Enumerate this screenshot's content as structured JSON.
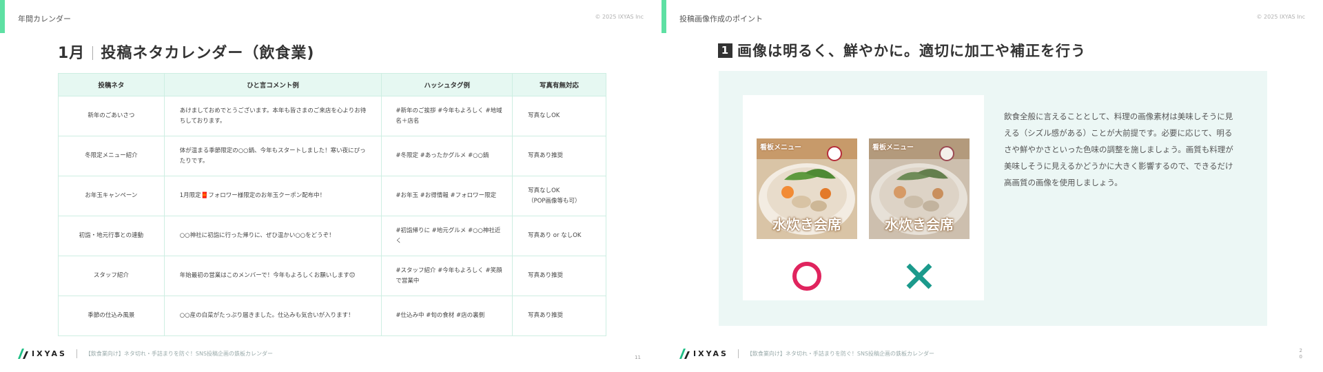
{
  "left": {
    "header": "年間カレンダー",
    "copyright": "© 2025 IXYAS Inc",
    "title_month": "1月",
    "title_text": "投稿ネタカレンダー（飲食業)",
    "table": {
      "headers": [
        "投稿ネタ",
        "ひと言コメント例",
        "ハッシュタグ例",
        "写真有無対応"
      ],
      "rows": [
        {
          "topic": "新年のごあいさつ",
          "comment": "あけましておめでとうございます。本年も皆さまのご来店を心よりお待ちしております。",
          "tags": "#新年のご挨拶 #今年もよろしく #地域名＋店名",
          "photo": "写真なしOK",
          "photo2": ""
        },
        {
          "topic": "冬限定メニュー紹介",
          "comment": "体が温まる季節限定の○○鍋、今年もスタートしました！寒い夜にぴったりです。",
          "tags": "#冬限定 #あったかグルメ #○○鍋",
          "photo": "写真あり推奨",
          "photo2": ""
        },
        {
          "topic": "お年玉キャンペーン",
          "comment": "1月限定🧧フォロワー様限定のお年玉クーポン配布中！",
          "tags": "#お年玉 #お得情報 #フォロワー限定",
          "photo": "写真なしOK",
          "photo2": "（POP画像等も可）"
        },
        {
          "topic": "初詣・地元行事との連動",
          "comment": "○○神社に初詣に行った帰りに、ぜひ温かい○○をどうぞ！",
          "tags": "#初詣帰りに #地元グルメ #○○神社近く",
          "photo": "写真あり or なしOK",
          "photo2": ""
        },
        {
          "topic": "スタッフ紹介",
          "comment": "年始最初の営業はこのメンバーで！今年もよろしくお願いします😊",
          "tags": "#スタッフ紹介 #今年もよろしく #笑顔で営業中",
          "photo": "写真あり推奨",
          "photo2": ""
        },
        {
          "topic": "季節の仕込み風景",
          "comment": "○○産の白菜がたっぷり届きました。仕込みも気合いが入ります！",
          "tags": "#仕込み中 #旬の食材 #店の裏側",
          "photo": "写真あり推奨",
          "photo2": ""
        }
      ]
    },
    "footer": {
      "logo": "IXYAS",
      "text": "【飲食業向け】ネタ切れ・手詰まりを防ぐ！SNS投稿企画の鉄板カレンダー"
    },
    "page_number": "11"
  },
  "right": {
    "header": "投稿画像作成のポイント",
    "copyright": "© 2025 IXYAS Inc",
    "badge": "1",
    "title": "画像は明るく、鮮やかに。適切に加工や補正を行う",
    "image_title": "水炊き会席",
    "image_label": "看板メニュー",
    "good_mark": "○",
    "bad_mark": "×",
    "description": "飲食全般に言えることとして、料理の画像素材は美味しそうに見える（シズル感がある）ことが大前提です。必要に応じて、明るさや鮮やかさといった色味の調整を施しましょう。画質も料理が美味しそうに見えるかどうかに大きく影響するので、できるだけ高画質の画像を使用しましょう。",
    "footer": {
      "logo": "IXYAS",
      "text": "【飲食業向け】ネタ切れ・手詰まりを防ぐ！SNS投稿企画の鉄板カレンダー"
    },
    "page_number": "2\n0"
  },
  "colors": {
    "accent": "#5ee0a3",
    "table_header_bg": "#e6f8f2",
    "panel_bg": "#ecf7f5",
    "good": "#e0245e",
    "bad": "#1b9a8c"
  }
}
